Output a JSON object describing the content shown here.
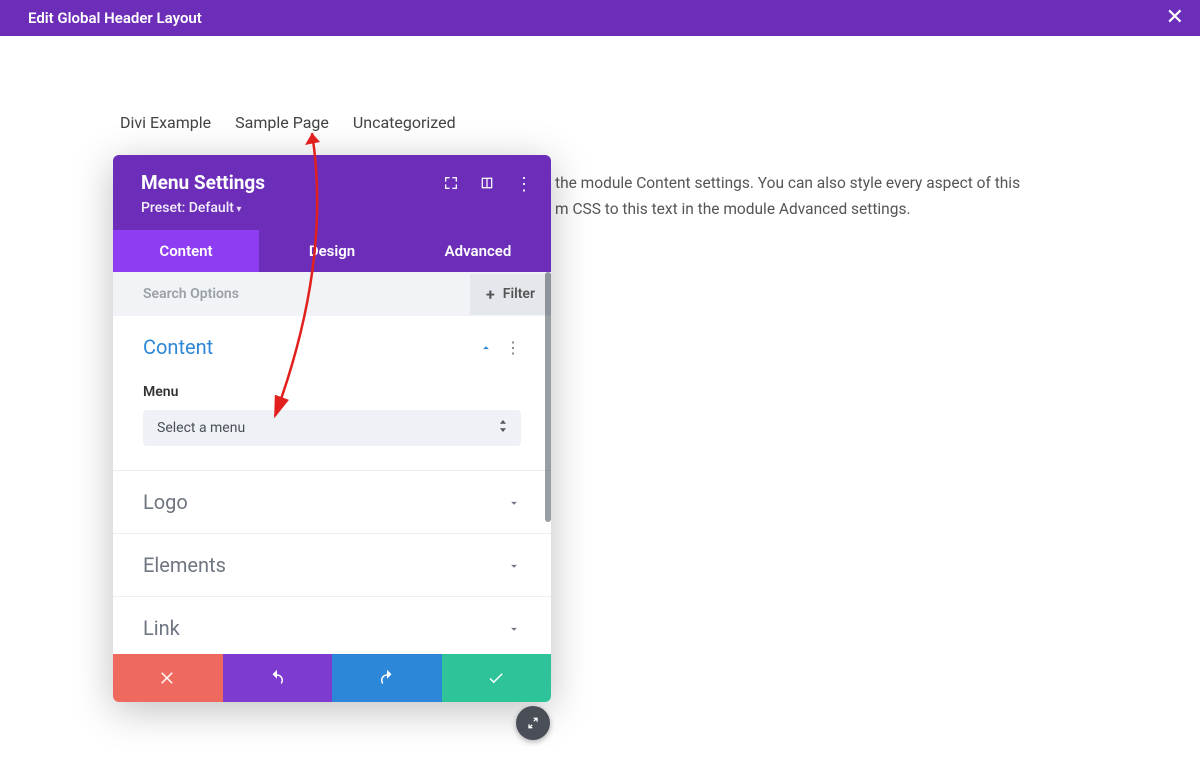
{
  "topbar": {
    "title": "Edit Global Header Layout"
  },
  "nav": {
    "item0": "Divi Example",
    "item1": "Sample Page",
    "item2": "Uncategorized"
  },
  "bgtext": {
    "line1": "the module Content settings. You can also style every aspect of this",
    "line2": "m CSS to this text in the module Advanced settings."
  },
  "panel": {
    "title": "Menu Settings",
    "preset": "Preset: Default",
    "tabs": {
      "content": "Content",
      "design": "Design",
      "advanced": "Advanced"
    },
    "search_placeholder": "Search Options",
    "filter": "Filter",
    "sections": {
      "content": {
        "title": "Content",
        "menu_label": "Menu",
        "menu_select": "Select a menu"
      },
      "logo": "Logo",
      "elements": "Elements",
      "link": "Link"
    }
  }
}
